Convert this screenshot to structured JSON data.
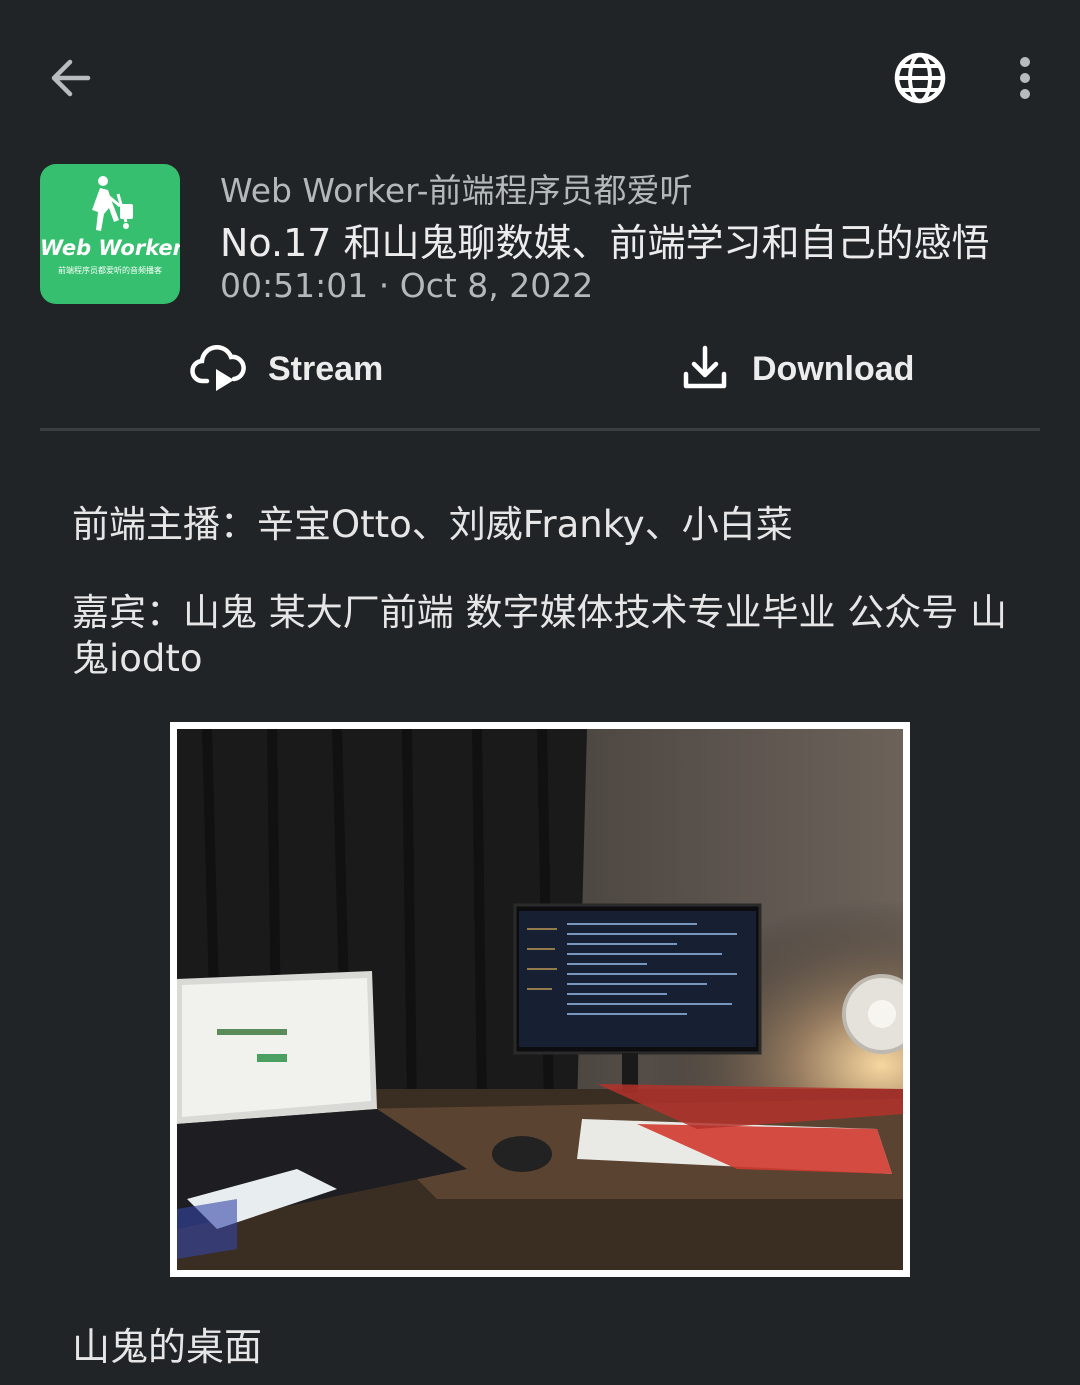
{
  "toolbar": {
    "back_icon": "arrow-left-icon",
    "globe_icon": "globe-icon",
    "more_icon": "more-vertical-icon"
  },
  "episode": {
    "logo_title": "Web Worker",
    "logo_subtitle": "前端程序员都爱听的音频播客",
    "podcast_name": "Web Worker-前端程序员都爱听",
    "title": "No.17 和山鬼聊数媒、前端学习和自己的感悟",
    "duration": "00:51:01",
    "separator": "·",
    "date": "Oct 8, 2022"
  },
  "actions": {
    "stream_label": "Stream",
    "stream_icon": "cloud-play-icon",
    "download_label": "Download",
    "download_icon": "download-icon"
  },
  "description": {
    "hosts": "前端主播：辛宝Otto、刘威Franky、小白菜",
    "guest": "嘉宾：山鬼 某大厂前端 数字媒体技术专业毕业 公众号 山鬼iodto",
    "photo_caption": "山鬼的桌面"
  },
  "colors": {
    "background": "#212427",
    "logo_green": "#35bf6e",
    "text_primary": "#ececec",
    "text_secondary": "#b5b8bb"
  }
}
